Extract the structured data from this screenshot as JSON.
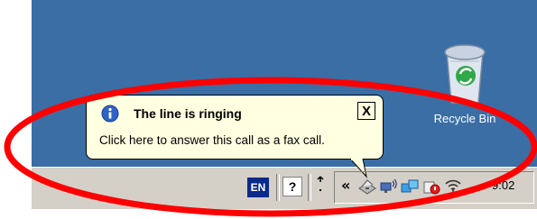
{
  "desktop": {
    "recycle_bin_label": "Recycle Bin"
  },
  "balloon": {
    "title": "The line is ringing",
    "message": "Click here to answer this call as a fax call.",
    "close_label": "X"
  },
  "taskbar": {
    "language": "EN",
    "help_label": "?",
    "tray_expand": "«",
    "clock": "9:02"
  },
  "colors": {
    "desktop": "#3a6ea5",
    "taskbar": "#d4d0c8",
    "balloon_bg": "#ffffe1",
    "highlight_ellipse": "#ff0000"
  }
}
